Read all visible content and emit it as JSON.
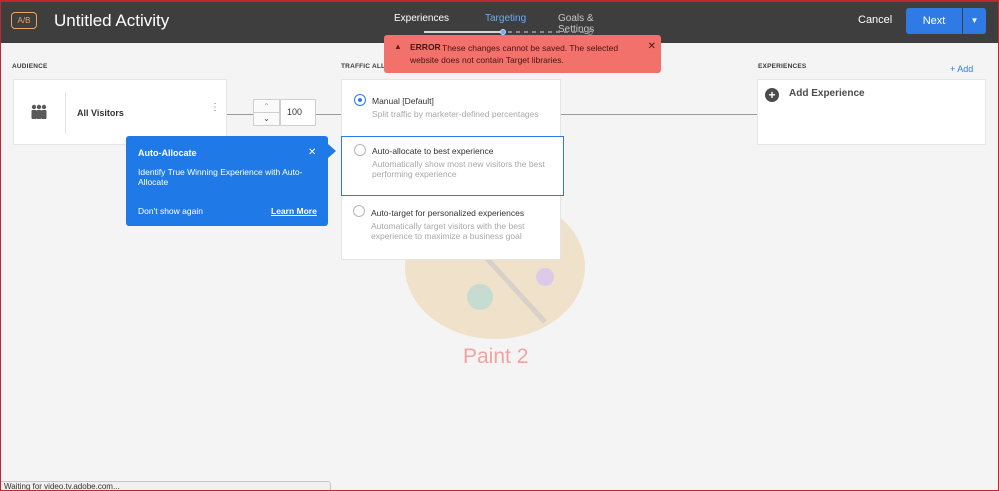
{
  "header": {
    "badge": "A/B",
    "title": "Untitled Activity",
    "steps": [
      {
        "label": "Experiences"
      },
      {
        "label": "Targeting"
      },
      {
        "label": "Goals & Settings"
      }
    ],
    "cancel_label": "Cancel",
    "next_label": "Next"
  },
  "error": {
    "label": "ERROR",
    "message": "These changes cannot be saved. The selected website does not contain Target libraries."
  },
  "sections": {
    "audience": "AUDIENCE",
    "traffic": "TRAFFIC ALLOC",
    "experiences": "EXPERIENCES"
  },
  "audience": {
    "name": "All Visitors"
  },
  "allocation": {
    "value": "100"
  },
  "traffic_options": [
    {
      "title": "Manual [Default]",
      "description": "Split traffic by marketer-defined percentages",
      "selected": true
    },
    {
      "title": "Auto-allocate to best experience",
      "description": "Automatically show most new visitors the best performing experience",
      "selected": false
    },
    {
      "title": "Auto-target for personalized experiences",
      "description": "Automatically target visitors with the best experience to maximize a business goal",
      "selected": false
    }
  ],
  "experiences": {
    "add_label": "Add",
    "add_experience_label": "Add Experience"
  },
  "tooltip": {
    "title": "Auto-Allocate",
    "body": "Identify True Winning Experience with Auto-Allocate",
    "dismiss_label": "Don't show again",
    "learn_more_label": "Learn More"
  },
  "watermark": {
    "label": "Paint 2"
  },
  "status_bar": {
    "text": "Waiting for video.tv.adobe.com..."
  },
  "colors": {
    "topbar": "#3e3e3e",
    "accent": "#2f7ae5",
    "error": "#f2716a",
    "tooltip": "#1f7ae8"
  }
}
